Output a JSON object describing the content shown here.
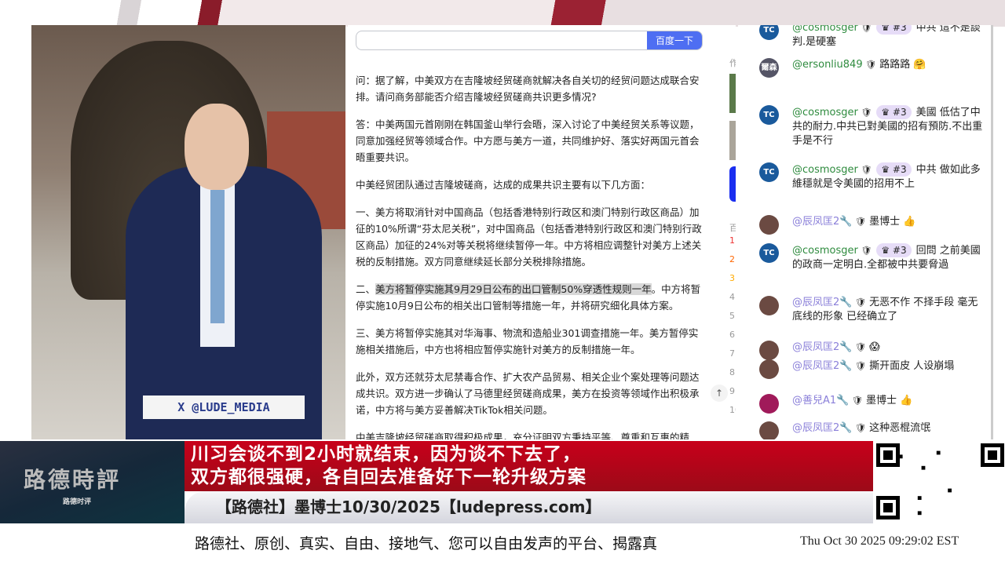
{
  "video": {
    "watermark": "X @LUDE_MEDIA"
  },
  "browser": {
    "search_button": "百度一下",
    "search_value": "",
    "paragraphs": [
      "问：据了解，中美双方在吉隆坡经贸磋商就解决各自关切的经贸问题达成联合安排。请问商务部能否介绍吉隆坡经贸磋商共识更多情况?",
      "答：中美两国元首刚刚在韩国釜山举行会晤，深入讨论了中美经贸关系等议题，同意加强经贸等领域合作。中方愿与美方一道，共同维护好、落实好两国元首会晤重要共识。",
      "中美经贸团队通过吉隆坡磋商，达成的成果共识主要有以下几方面：",
      "一、美方将取消针对中国商品（包括香港特别行政区和澳门特别行政区商品）加征的10%所谓“芬太尼关税”，对中国商品（包括香港特别行政区和澳门特别行政区商品）加征的24%对等关税将继续暂停一年。中方将相应调整针对美方上述关税的反制措施。双方同意继续延长部分关税排除措施。",
      "三、美方将暂停实施其对华海事、物流和造船业301调查措施一年。美方暂停实施相关措施后，中方也将相应暂停实施针对美方的反制措施一年。",
      "此外，双方还就芬太尼禁毒合作、扩大农产品贸易、相关企业个案处理等问题达成共识。双方进一步确认了马德里经贸磋商成果，美方在投资等领域作出积极承诺，中方将与美方妥善解决TikTok相关问题。",
      "中美吉隆坡经贸磋商取得积极成果，充分证明双方秉持平等、尊重和互惠的精神，通过开展对话与合作，能找到解决问题的办法。经贸磋商成果来之不易，中方期待"
    ],
    "p2_prefix": "二、",
    "p2_highlight": "美方将暂停实施其9月29日公布的出口管制50%穿透性规则一年",
    "p2_rest": "。中方将暂停实施10月9日公布的相关出口管制等措施一年，并将研究细化具体方案。",
    "side_label": "作",
    "side_label2": "百",
    "ranks": [
      "1",
      "2",
      "3",
      "4",
      "5",
      "6",
      "7",
      "8",
      "9",
      "10"
    ]
  },
  "chat": {
    "messages": [
      {
        "avatar": "TC",
        "user": "@cosmosger",
        "badge": "#3",
        "text": "中共 這不是談判.是硬塞"
      },
      {
        "avatar": "爾森",
        "user": "@ersonliu849",
        "text": "路路路 🤗"
      },
      {
        "avatar": "TC",
        "user": "@cosmosger",
        "badge": "#3",
        "text": "美國 低估了中共的耐力.中共已對美國的招有預防.不出重手是不行"
      },
      {
        "avatar": "TC",
        "user": "@cosmosger",
        "badge": "#3",
        "text": "中共 做如此多維穩就是令美國的招用不上"
      },
      {
        "avatar": "",
        "user": "@辰凤匡2",
        "text": "墨博士 👍"
      },
      {
        "avatar": "TC",
        "user": "@cosmosger",
        "badge": "#3",
        "text": "回問 之前美國的政商一定明白.全都被中共要脅過"
      },
      {
        "avatar": "",
        "user": "@辰凤匡2",
        "text": "无恶不作 不择手段 毫无底线的形象 已经确立了"
      },
      {
        "avatar": "",
        "user": "@辰凤匡2",
        "text": "😱"
      },
      {
        "avatar": "",
        "user": "@辰凤匡2",
        "text": "撕开面皮 人设崩塌"
      },
      {
        "avatar": "",
        "user": "@善兒A1",
        "text": "墨博士 👍"
      },
      {
        "avatar": "",
        "user": "@辰凤匡2",
        "text": "这种恶棍流氓"
      }
    ]
  },
  "banner": {
    "logo": "路德時評",
    "logo_sub": "路德时评",
    "headline1": "川习会谈不到2小时就结束，因为谈不下去了，",
    "headline2": "双方都很强硬，各自回去准备好下一轮升级方案",
    "subline": "【路德社】墨博士10/30/2025【ludepress.com】"
  },
  "ticker": {
    "text": "路德社、原创、真实、自由、接地气、您可以自由发声的平台、揭露真",
    "clock": "Thu Oct 30 2025 09:29:02 EST"
  }
}
